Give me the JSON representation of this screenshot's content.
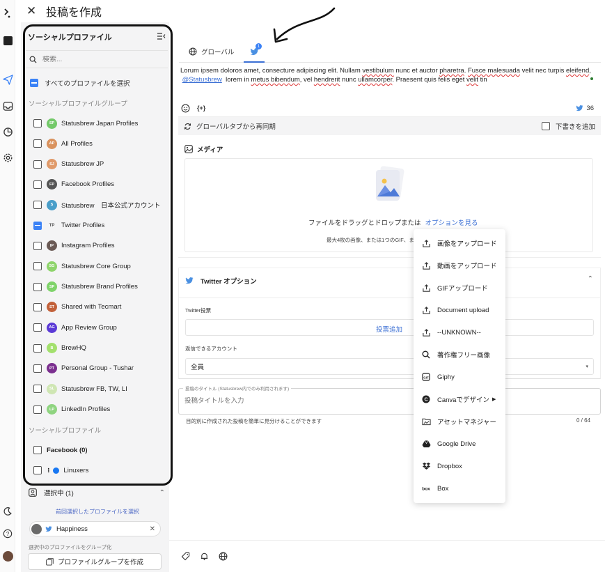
{
  "header": {
    "title": "投稿を作成"
  },
  "profiles_panel": {
    "title": "ソーシャルプロファイル",
    "search_placeholder": "検索...",
    "select_all": "すべてのプロファイルを選択",
    "groups_label": "ソーシャルプロファイルグループ",
    "groups": [
      {
        "initials": "SP",
        "name": "Statusbrew Japan Profiles",
        "color": "#74c96a",
        "state": "unchecked"
      },
      {
        "initials": "AP",
        "name": "All Profiles",
        "color": "#d9925e",
        "state": "unchecked"
      },
      {
        "initials": "SJ",
        "name": "Statusbrew JP",
        "color": "#e09a6a",
        "state": "unchecked"
      },
      {
        "initials": "FP",
        "name": "Facebook Profiles",
        "color": "#555555",
        "state": "unchecked"
      },
      {
        "initials": "S",
        "name": "Statusbrew　日本公式アカウント",
        "color": "#4a9ec9",
        "state": "unchecked"
      },
      {
        "initials": "TP",
        "name": "Twitter Profiles",
        "color": "transparent",
        "state": "indeterminate"
      },
      {
        "initials": "IP",
        "name": "Instagram Profiles",
        "color": "#6a5a55",
        "state": "unchecked"
      },
      {
        "initials": "SG",
        "name": "Statusbrew Core Group",
        "color": "#8ed46b",
        "state": "unchecked"
      },
      {
        "initials": "SP",
        "name": "Statusbrew Brand Profiles",
        "color": "#7fd36a",
        "state": "unchecked"
      },
      {
        "initials": "ST",
        "name": "Shared with Tecmart",
        "color": "#c2613a",
        "state": "unchecked"
      },
      {
        "initials": "AG",
        "name": "App Review Group",
        "color": "#5b3ad6",
        "state": "unchecked"
      },
      {
        "initials": "B",
        "name": "BrewHQ",
        "color": "#a3e06d",
        "state": "unchecked"
      },
      {
        "initials": "PT",
        "name": "Personal Group - Tushar",
        "color": "#7b2f8f",
        "state": "unchecked"
      },
      {
        "initials": "SL",
        "name": "Statusbrew FB, TW, LI",
        "color": "#cfe6b3",
        "state": "unchecked"
      },
      {
        "initials": "LP",
        "name": "LinkedIn Profiles",
        "color": "#8fd480",
        "state": "unchecked"
      }
    ],
    "profiles_label": "ソーシャルプロファイル",
    "profiles": [
      {
        "name": "Facebook (0)",
        "bold": true
      },
      {
        "name": "Linuxers",
        "bold": false
      }
    ],
    "selected_label": "選択中 (1)",
    "previous_link": "前回選択したプロファイルを選択",
    "selected_chip": "Happiness",
    "group_caption": "選択中のプロファイルをグループ化",
    "create_group_button": "プロファイルグループを作成"
  },
  "composer": {
    "tab_global": "グローバル",
    "tab_twitter_badge": "1",
    "text_1": "Lorum ipsem doloros amet, consecture adipiscing elit. Nullam",
    "text_sq1": "vestibulum",
    "text_2": "nunc et auctor",
    "text_sq2": "pharetra",
    "text_3": ".",
    "text_sq3": "Fusce malesuada",
    "text_4": "velit nec turpis",
    "text_sq4": "eleifend",
    "text_5": ",",
    "mention": "@Statusbrew",
    "text_6": "lorem in",
    "text_sq5": "metus bibendum",
    "text_7": ", vel",
    "text_sq6": "hendrerit",
    "text_8": "nunc",
    "text_sq7": "ullamcorper",
    "text_9": ". Praesent quis felis eget",
    "text_sq8": "velit",
    "text_10": "tin",
    "variable_token": "{+}",
    "char_count": "36",
    "resync": "グローバルタブから再同期",
    "draft_label": "下書きを追加"
  },
  "media": {
    "title": "メディア",
    "drop_text": "ファイルをドラッグとドロップまたは",
    "options_link": "オプションを見る",
    "sub_text": "最大4枚の画像、または1つのGIF、ま"
  },
  "twitter_options": {
    "title": "Twitter オプション",
    "poll_label": "Twitter投票",
    "poll_add": "投票追加",
    "reply_label": "返信できるアカウント",
    "reply_value": "全員"
  },
  "post_title": {
    "legend": "投稿のタイトル (Statusbrew内でのみ利用されます)",
    "placeholder": "投稿タイトルを入力",
    "help": "目的別に作成された投稿を簡単に見分けることができます",
    "count": "0 / 64"
  },
  "upload_menu": [
    {
      "icon": "upload-icon",
      "label": "画像をアップロード"
    },
    {
      "icon": "upload-icon",
      "label": "動画をアップロード"
    },
    {
      "icon": "upload-icon",
      "label": "GIFアップロード"
    },
    {
      "icon": "upload-icon",
      "label": "Document upload"
    },
    {
      "icon": "upload-icon",
      "label": "--UNKNOWN--"
    },
    {
      "icon": "search-icon",
      "label": "著作権フリー画像"
    },
    {
      "icon": "giphy-icon",
      "label": "Giphy"
    },
    {
      "icon": "canva-icon",
      "label": "Canvaでデザイン",
      "submenu": true
    },
    {
      "icon": "asset-manager-icon",
      "label": "アセットマネジャー"
    },
    {
      "icon": "google-drive-icon",
      "label": "Google Drive"
    },
    {
      "icon": "dropbox-icon",
      "label": "Dropbox"
    },
    {
      "icon": "box-icon",
      "label": "Box"
    }
  ],
  "colors": {
    "accent": "#3b82f6",
    "link": "#3b6fd4",
    "twitter": "#4a90e2",
    "panel_bg": "#f4f4f5"
  }
}
